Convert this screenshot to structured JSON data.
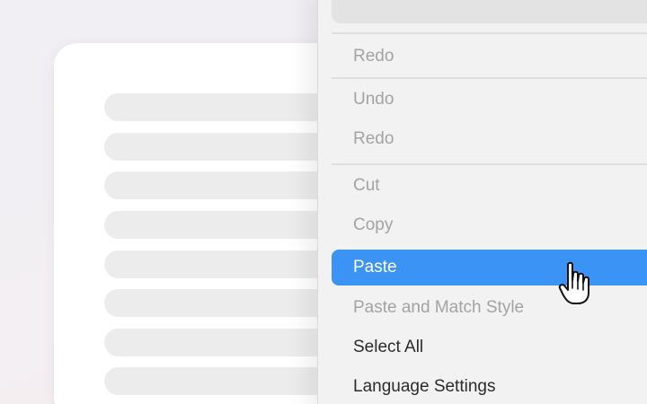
{
  "menu": {
    "items": [
      {
        "label": "Redo"
      },
      {
        "label": "Undo"
      },
      {
        "label": "Redo"
      },
      {
        "label": "Cut"
      },
      {
        "label": "Copy"
      },
      {
        "label": "Paste"
      },
      {
        "label": "Paste and Match Style"
      },
      {
        "label": "Select All"
      },
      {
        "label": "Language Settings"
      }
    ]
  },
  "colors": {
    "highlight": "#3b93f5",
    "disabled_text": "#a3a3a3",
    "enabled_text": "#2b2b2b"
  },
  "icons": {
    "pointer": "hand-pointer-icon"
  }
}
